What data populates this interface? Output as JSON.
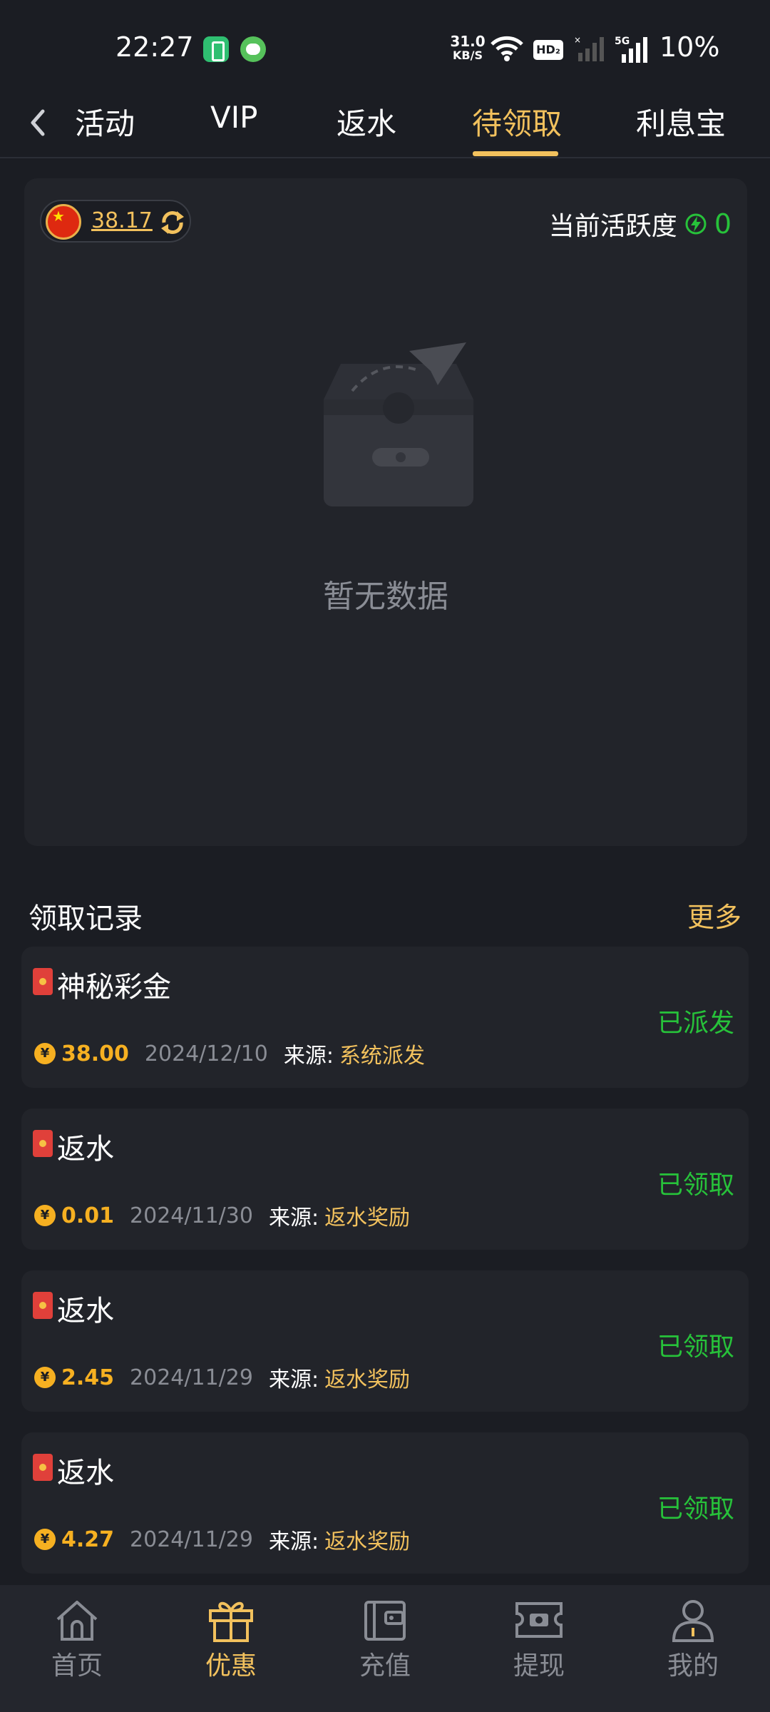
{
  "status_bar": {
    "time": "22:27",
    "net_speed_value": "31.0",
    "net_speed_unit": "KB/S",
    "hd_label": "HD₂",
    "network_label": "5G",
    "battery": "10%"
  },
  "tabs": [
    {
      "label": "活动",
      "active": false
    },
    {
      "label": "VIP",
      "active": false
    },
    {
      "label": "返水",
      "active": false
    },
    {
      "label": "待领取",
      "active": true
    },
    {
      "label": "利息宝",
      "active": false
    }
  ],
  "panel": {
    "balance": "38.17",
    "activity_label": "当前活跃度",
    "activity_value": "0",
    "empty_text": "暂无数据"
  },
  "records": {
    "title": "领取记录",
    "more": "更多",
    "source_label": "来源:",
    "items": [
      {
        "title": "神秘彩金",
        "status": "已派发",
        "amount": "38.00",
        "date": "2024/12/10",
        "source": "系统派发"
      },
      {
        "title": "返水",
        "status": "已领取",
        "amount": "0.01",
        "date": "2024/11/30",
        "source": "返水奖励"
      },
      {
        "title": "返水",
        "status": "已领取",
        "amount": "2.45",
        "date": "2024/11/29",
        "source": "返水奖励"
      },
      {
        "title": "返水",
        "status": "已领取",
        "amount": "4.27",
        "date": "2024/11/29",
        "source": "返水奖励"
      }
    ]
  },
  "bottom_nav": [
    {
      "label": "首页",
      "icon": "home-icon",
      "active": false
    },
    {
      "label": "优惠",
      "icon": "gift-icon",
      "active": true
    },
    {
      "label": "充值",
      "icon": "wallet-icon",
      "active": false
    },
    {
      "label": "提现",
      "icon": "withdraw-icon",
      "active": false
    },
    {
      "label": "我的",
      "icon": "profile-icon",
      "active": false
    }
  ],
  "colors": {
    "accent": "#f2c15d",
    "success": "#27c23a",
    "background": "#1b1d23",
    "card": "#22242a"
  }
}
